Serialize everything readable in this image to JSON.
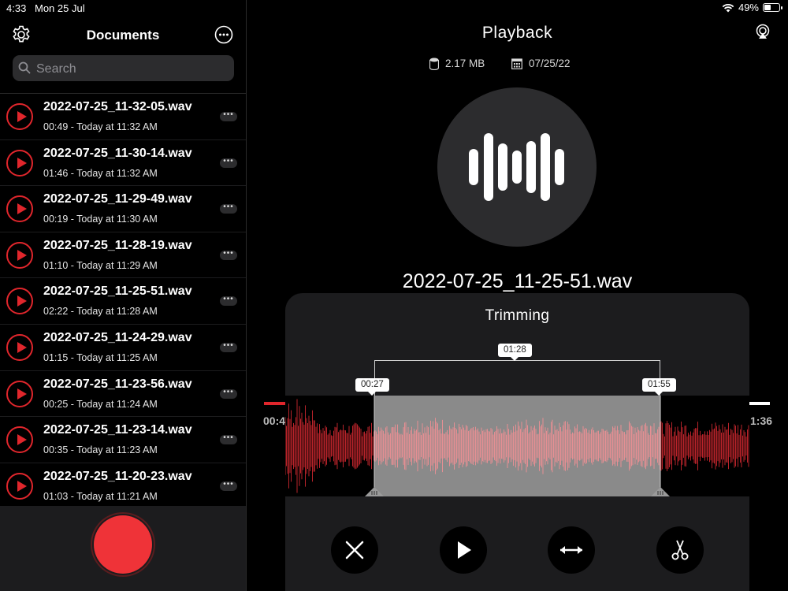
{
  "status": {
    "time": "4:33",
    "date": "Mon 25 Jul",
    "battery": "49%",
    "battery_level": 0.49
  },
  "sidebar": {
    "title": "Documents",
    "search": {
      "placeholder": "Search",
      "value": ""
    },
    "recordings": [
      {
        "name": "2022-07-25_11-32-05.wav",
        "meta": "00:49 - Today at 11:32 AM"
      },
      {
        "name": "2022-07-25_11-30-14.wav",
        "meta": "01:46 - Today at 11:32 AM"
      },
      {
        "name": "2022-07-25_11-29-49.wav",
        "meta": "00:19 - Today at 11:30 AM"
      },
      {
        "name": "2022-07-25_11-28-19.wav",
        "meta": "01:10 - Today at 11:29 AM"
      },
      {
        "name": "2022-07-25_11-25-51.wav",
        "meta": "02:22 - Today at 11:28 AM"
      },
      {
        "name": "2022-07-25_11-24-29.wav",
        "meta": "01:15 - Today at 11:25 AM"
      },
      {
        "name": "2022-07-25_11-23-56.wav",
        "meta": "00:25 - Today at 11:24 AM"
      },
      {
        "name": "2022-07-25_11-23-14.wav",
        "meta": "00:35 - Today at 11:23 AM"
      },
      {
        "name": "2022-07-25_11-20-23.wav",
        "meta": "01:03 - Today at 11:21 AM"
      }
    ],
    "more_dots": "•••"
  },
  "playback": {
    "title": "Playback",
    "file_size": "2.17 MB",
    "file_date": "07/25/22",
    "filename": "2022-07-25_11-25-51.wav"
  },
  "trimming": {
    "title": "Trimming",
    "duration_label": "01:28",
    "start_label": "00:27",
    "end_label": "01:55",
    "left_time": "00:4",
    "right_time": "1:36"
  },
  "colors": {
    "accent": "#e0262c",
    "record": "#ef3338",
    "panel": "#1c1c1e",
    "wave_dark": "#b8232a",
    "wave_light": "#e58f93"
  }
}
